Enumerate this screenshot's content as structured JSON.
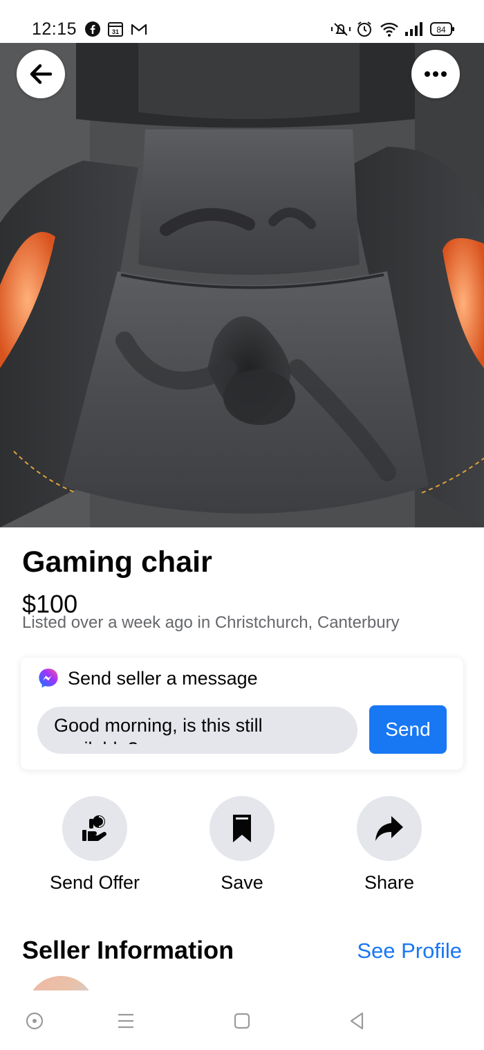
{
  "status_bar": {
    "time": "12:15",
    "battery": "84",
    "left_icons": [
      "facebook-icon",
      "calendar-icon",
      "gmail-icon"
    ],
    "right_icons": [
      "vibrate-mute-icon",
      "alarm-icon",
      "wifi-icon",
      "signal-icon",
      "battery-icon"
    ]
  },
  "listing": {
    "title": "Gaming chair",
    "price": "$100",
    "listed": "Listed over a week ago in Christchurch, Canterbury"
  },
  "message": {
    "header": "Send seller a message",
    "input_value": "Good morning, is this still available?",
    "send_label": "Send"
  },
  "actions": [
    {
      "label": "Send Offer",
      "icon": "offer-icon"
    },
    {
      "label": "Save",
      "icon": "bookmark-icon"
    },
    {
      "label": "Share",
      "icon": "share-arrow-icon"
    }
  ],
  "seller": {
    "heading": "Seller Information",
    "see_profile": "See Profile"
  },
  "colors": {
    "accent": "#1877f2",
    "secondary_text": "#65676b",
    "button_gray": "#e4e6eb"
  }
}
